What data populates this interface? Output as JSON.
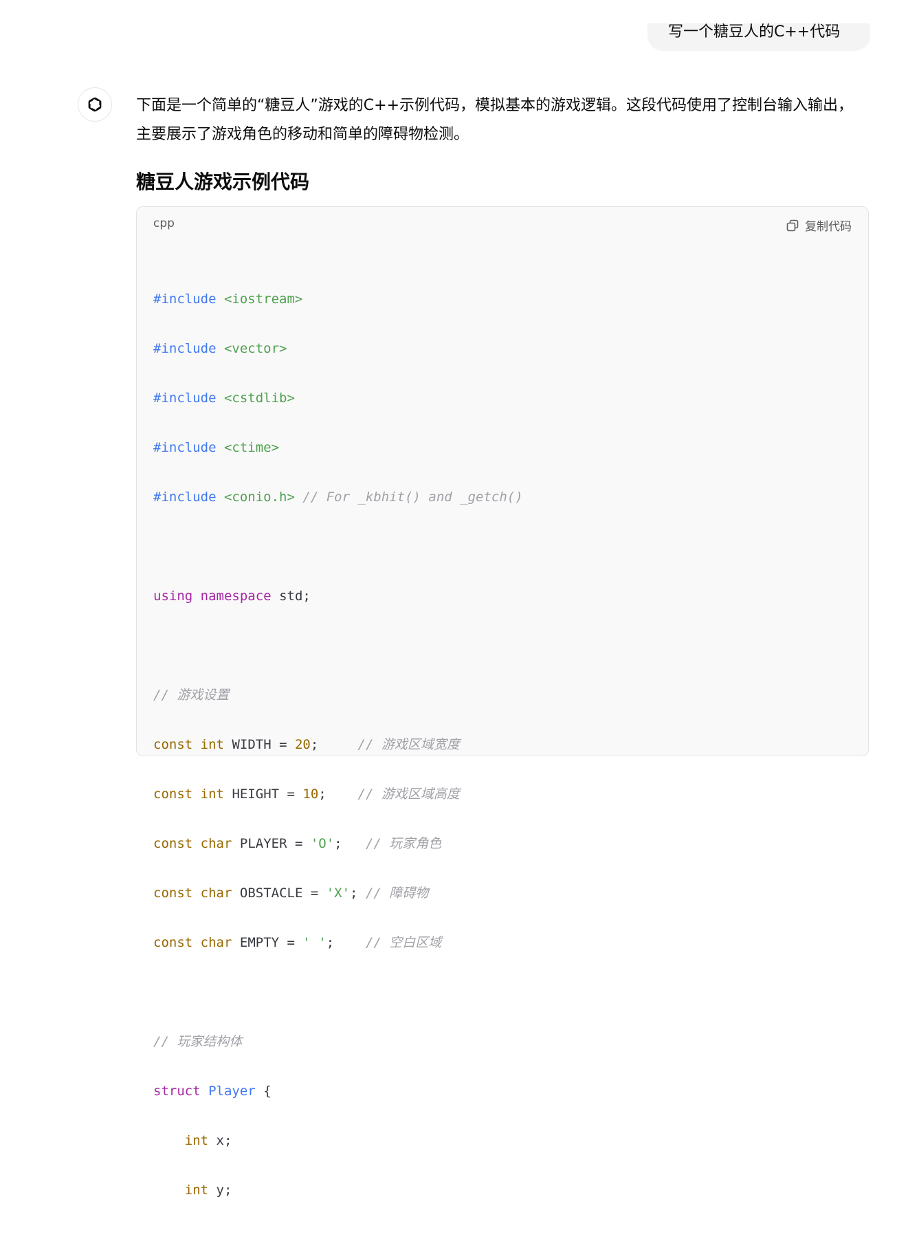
{
  "user_message": "写一个糖豆人的C++代码",
  "assistant": {
    "intro": "下面是一个简单的“糖豆人”游戏的C++示例代码，模拟基本的游戏逻辑。这段代码使用了控制台输入输出，主要展示了游戏角色的移动和简单的障碍物检测。",
    "heading": "糖豆人游戏示例代码"
  },
  "code_block": {
    "language": "cpp",
    "copy_label": "复制代码",
    "lines": {
      "l1a": "#include",
      "l1b": "<iostream>",
      "l2a": "#include",
      "l2b": "<vector>",
      "l3a": "#include",
      "l3b": "<cstdlib>",
      "l4a": "#include",
      "l4b": "<ctime>",
      "l5a": "#include",
      "l5b": "<conio.h>",
      "l5c": "// For _kbhit() and _getch()",
      "l7a": "using",
      "l7b": "namespace",
      "l7c": "std;",
      "l9": "// 游戏设置",
      "l10a": "const",
      "l10b": "int",
      "l10c": "WIDTH =",
      "l10d": "20",
      "l10e": ";",
      "l10f": "// 游戏区域宽度",
      "l11a": "const",
      "l11b": "int",
      "l11c": "HEIGHT =",
      "l11d": "10",
      "l11e": ";",
      "l11f": "// 游戏区域高度",
      "l12a": "const",
      "l12b": "char",
      "l12c": "PLAYER =",
      "l12d": "'O'",
      "l12e": ";",
      "l12f": "// 玩家角色",
      "l13a": "const",
      "l13b": "char",
      "l13c": "OBSTACLE =",
      "l13d": "'X'",
      "l13e": ";",
      "l13f": "// 障碍物",
      "l14a": "const",
      "l14b": "char",
      "l14c": "EMPTY =",
      "l14d": "' '",
      "l14e": ";",
      "l14f": "// 空白区域",
      "l16": "// 玩家结构体",
      "l17a": "struct",
      "l17b": "Player",
      "l17c": "{",
      "l18a": "int",
      "l18b": "x;",
      "l19a": "int",
      "l19b": "y;"
    }
  },
  "icons": {
    "avatar": "openai-logo-icon",
    "copy": "copy-icon"
  },
  "colors": {
    "preprocessor": "#4078f2",
    "string": "#50a14f",
    "keyword": "#a626a4",
    "type": "#986801",
    "comment": "#a0a1a7"
  }
}
